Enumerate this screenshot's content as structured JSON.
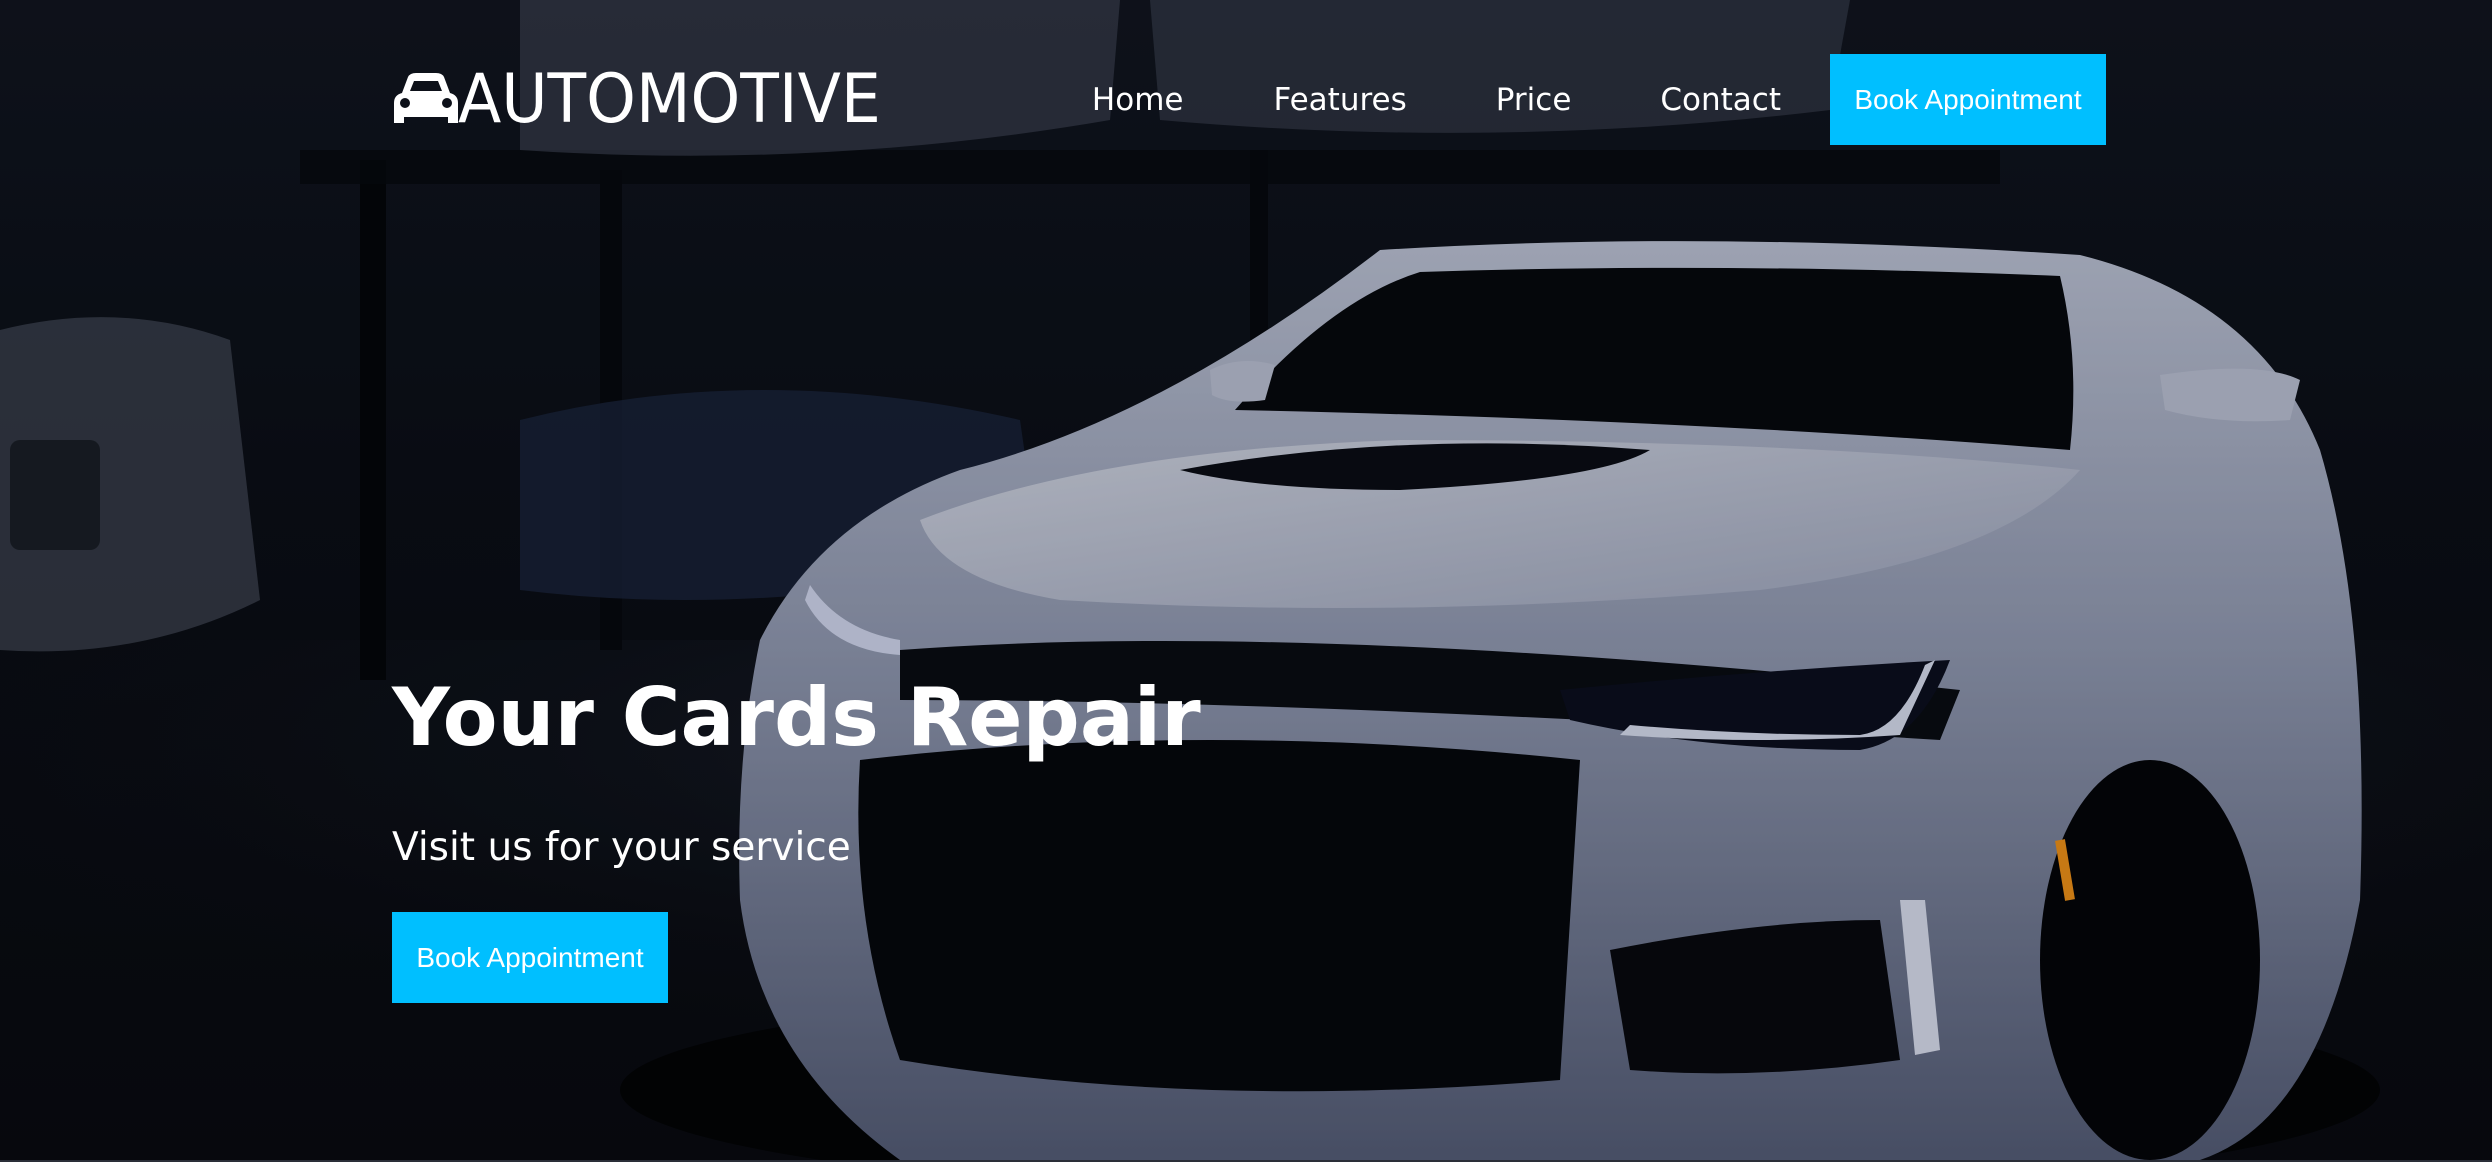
{
  "brand": {
    "name": "AUTOMOTIVE",
    "logo_icon": "car-icon"
  },
  "nav": {
    "items": [
      {
        "label": "Home"
      },
      {
        "label": "Features"
      },
      {
        "label": "Price"
      },
      {
        "label": "Contact"
      }
    ],
    "cta_label": "Book Appointment"
  },
  "hero": {
    "title": "Your Cards Repair",
    "subtitle": "Visit us for your service",
    "cta_label": "Book Appointment",
    "background_image": "dark garage with white sports car"
  },
  "colors": {
    "accent": "#00bfff",
    "text": "#ffffff"
  }
}
